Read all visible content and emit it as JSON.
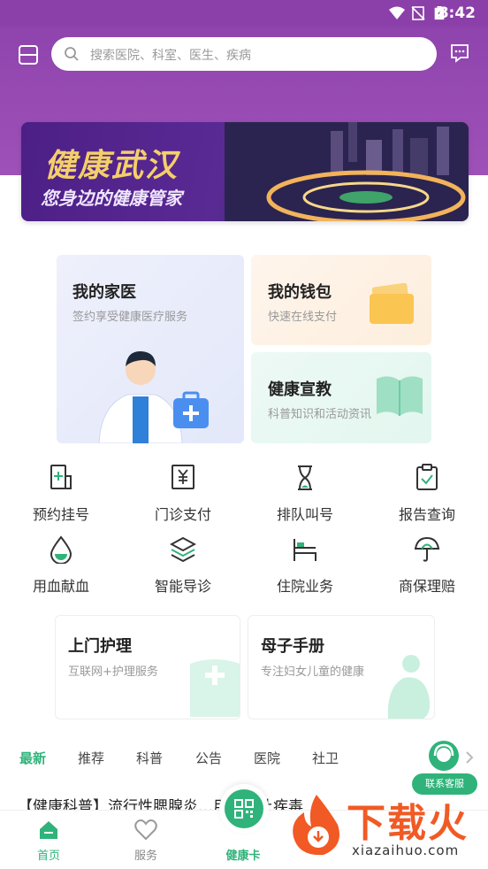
{
  "status": {
    "time": "8:42"
  },
  "header": {
    "search_placeholder": "搜索医院、科室、医生、疾病"
  },
  "banner": {
    "title": "健康武汉",
    "subtitle": "您身边的健康管家"
  },
  "cards": {
    "family_doctor": {
      "title": "我的家医",
      "subtitle": "签约享受健康医疗服务"
    },
    "wallet": {
      "title": "我的钱包",
      "subtitle": "快速在线支付"
    },
    "education": {
      "title": "健康宣教",
      "subtitle": "科普知识和活动资讯"
    },
    "home_care": {
      "title": "上门护理",
      "subtitle": "互联网+护理服务"
    },
    "maternal": {
      "title": "母子手册",
      "subtitle": "专注妇女儿童的健康"
    }
  },
  "grid": [
    {
      "label": "预约挂号",
      "icon": "register-icon"
    },
    {
      "label": "门诊支付",
      "icon": "payment-icon"
    },
    {
      "label": "排队叫号",
      "icon": "hourglass-icon"
    },
    {
      "label": "报告查询",
      "icon": "clipboard-icon"
    },
    {
      "label": "用血献血",
      "icon": "blood-drop-icon"
    },
    {
      "label": "智能导诊",
      "icon": "layers-icon"
    },
    {
      "label": "住院业务",
      "icon": "hospital-bed-icon"
    },
    {
      "label": "商保理赔",
      "icon": "umbrella-icon"
    }
  ],
  "tabs": [
    "最新",
    "推荐",
    "科普",
    "公告",
    "医院",
    "社卫"
  ],
  "customer_service": "联系客服",
  "article_title": "【健康科普】流行性腮腺炎…用，别让疾毒",
  "nav": {
    "home": "首页",
    "service": "服务",
    "health_card": "健康卡"
  },
  "watermark": {
    "text": "下载火",
    "domain": "xiazaihuo.com"
  },
  "colors": {
    "primary_purple": "#8f43ad",
    "accent_green": "#2fb37a"
  }
}
